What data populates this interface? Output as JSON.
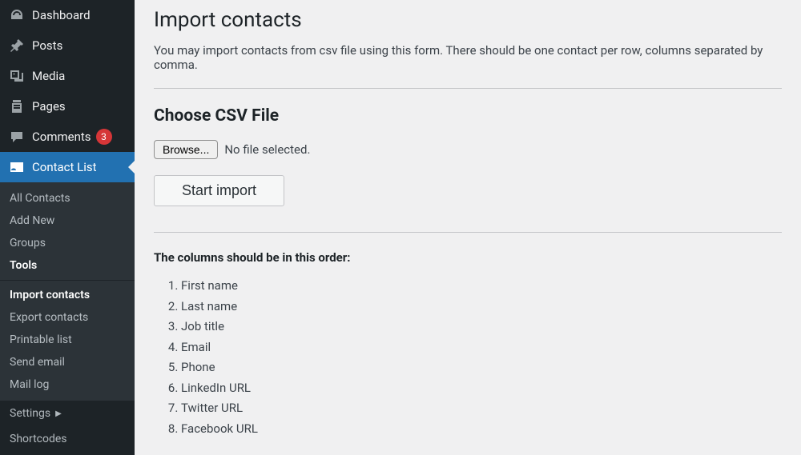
{
  "sidebar": {
    "items": [
      {
        "label": "Dashboard",
        "icon": "dashboard"
      },
      {
        "label": "Posts",
        "icon": "pin"
      },
      {
        "label": "Media",
        "icon": "media"
      },
      {
        "label": "Pages",
        "icon": "pages"
      },
      {
        "label": "Comments",
        "icon": "comments",
        "badge": "3"
      },
      {
        "label": "Contact List",
        "icon": "card",
        "active": true
      }
    ],
    "submenu": [
      {
        "label": "All Contacts"
      },
      {
        "label": "Add New"
      },
      {
        "label": "Groups"
      },
      {
        "label": "Tools",
        "bold": true
      },
      {
        "label": "Import contacts",
        "bold": true
      },
      {
        "label": "Export contacts"
      },
      {
        "label": "Printable list"
      },
      {
        "label": "Send email"
      },
      {
        "label": "Mail log"
      }
    ],
    "settings_label": "Settings",
    "shortcodes_label": "Shortcodes"
  },
  "page": {
    "title": "Import contacts",
    "intro": "You may import contacts from csv file using this form. There should be one contact per row, columns separated by comma.",
    "section_title": "Choose CSV File",
    "browse_label": "Browse...",
    "file_status": "No file selected.",
    "start_label": "Start import",
    "columns_title": "The columns should be in this order:",
    "columns": [
      "First name",
      "Last name",
      "Job title",
      "Email",
      "Phone",
      "LinkedIn URL",
      "Twitter URL",
      "Facebook URL"
    ]
  }
}
